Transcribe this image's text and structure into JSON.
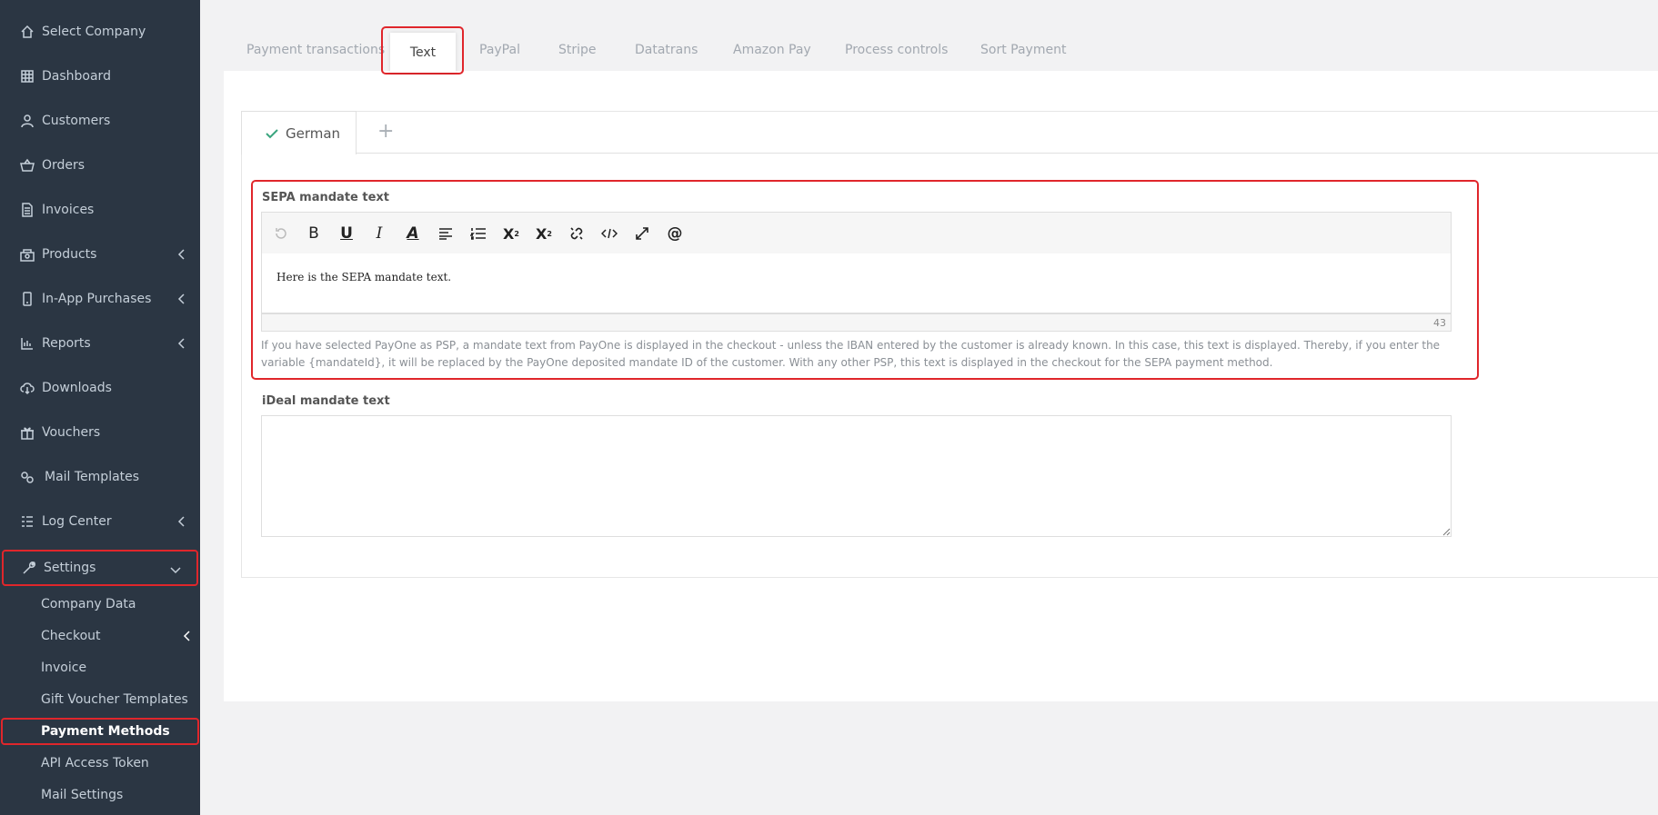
{
  "sidebar": {
    "items": [
      {
        "label": "Select Company",
        "icon": "home-icon"
      },
      {
        "label": "Dashboard",
        "icon": "grid-icon"
      },
      {
        "label": "Customers",
        "icon": "user-icon"
      },
      {
        "label": "Orders",
        "icon": "basket-icon"
      },
      {
        "label": "Invoices",
        "icon": "document-icon"
      },
      {
        "label": "Products",
        "icon": "products-icon"
      },
      {
        "label": "In-App Purchases",
        "icon": "phone-icon"
      },
      {
        "label": "Reports",
        "icon": "reports-icon"
      },
      {
        "label": "Downloads",
        "icon": "cloud-download-icon"
      },
      {
        "label": "Vouchers",
        "icon": "gift-icon"
      },
      {
        "label": "Mail Templates",
        "icon": "gears-icon"
      },
      {
        "label": "Log Center",
        "icon": "log-icon"
      },
      {
        "label": "Settings",
        "icon": "wrench-icon"
      }
    ],
    "settings_sub": [
      {
        "label": "Company Data"
      },
      {
        "label": "Checkout"
      },
      {
        "label": "Invoice"
      },
      {
        "label": "Gift Voucher Templates"
      },
      {
        "label": "Payment Methods"
      },
      {
        "label": "API Access Token"
      },
      {
        "label": "Mail Settings"
      }
    ]
  },
  "tabs": [
    {
      "label": "Payment transactions"
    },
    {
      "label": "Text"
    },
    {
      "label": "PayPal"
    },
    {
      "label": "Stripe"
    },
    {
      "label": "Datatrans"
    },
    {
      "label": "Amazon Pay"
    },
    {
      "label": "Process controls"
    },
    {
      "label": "Sort Payment"
    }
  ],
  "language_tab": {
    "label": "German",
    "add": "+"
  },
  "sepa": {
    "label": "SEPA mandate text",
    "content": "Here is the SEPA mandate text.",
    "char_count": "43",
    "help": "If you have selected PayOne as PSP, a mandate text from PayOne is displayed in the checkout - unless the IBAN entered by the customer is already known. In this case, this text is displayed. Thereby, if you enter the variable {mandateId}, it will be replaced by the PayOne deposited mandate ID of the customer. With any other PSP, this text is displayed in the checkout for the SEPA payment method."
  },
  "ideal": {
    "label": "iDeal mandate text",
    "value": ""
  },
  "colors": {
    "sidebar_bg": "#2b3643",
    "highlight": "#e0262b",
    "check": "#3aa57e"
  }
}
